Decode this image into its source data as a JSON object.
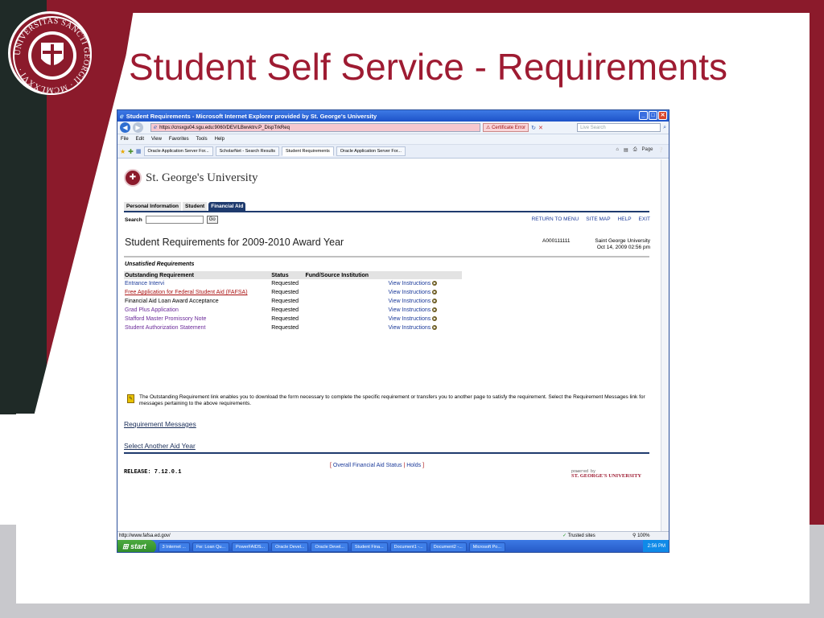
{
  "slide": {
    "title": "Student Self Service - Requirements",
    "seal_text": "UNIVERSITAS SANCTI GEORGII · MCMLXXVI ·",
    "colors": {
      "brand": "#8b1a2b",
      "title": "#9e1b32"
    }
  },
  "browser": {
    "title": "Student Requirements - Microsoft Internet Explorer provided by St. George's University",
    "address": "https://cnsxgu04.sgu.edu:9060/DEV/LBwvktrv.P_DispTrkReq",
    "cert_error": "Certificate Error",
    "search_placeholder": "Live Search",
    "menu": [
      "File",
      "Edit",
      "View",
      "Favorites",
      "Tools",
      "Help"
    ],
    "tabs": [
      "Oracle Application Server For...",
      "ScholarNet - Search Results",
      "Student Requirements",
      "Oracle Application Server For..."
    ],
    "tools": {
      "page": "Page",
      "tools": ""
    },
    "status_url": "http://www.fafsa.ed.gov/",
    "status_zone": "Trusted sites",
    "status_zoom": "100%"
  },
  "page": {
    "university": "St. George's University",
    "ptabs": [
      "Personal Information",
      "Student",
      "Financial Aid"
    ],
    "search_label": "Search",
    "go_label": "Go",
    "top_links": [
      "RETURN TO MENU",
      "SITE MAP",
      "HELP",
      "EXIT"
    ],
    "heading": "Student Requirements for 2009-2010 Award Year",
    "student_id": "A000111111",
    "institution": "Saint George University",
    "date": "Oct 14, 2009 02:56 pm",
    "unsatisfied_label": "Unsatisfied Requirements",
    "columns": [
      "Outstanding Requirement",
      "Status",
      "Fund/Source Institution"
    ],
    "rows": [
      {
        "requirement": "Entrance Intervi",
        "status": "Requested",
        "instructions": "View Instructions"
      },
      {
        "requirement": "Free Application for Federal Student Aid (FAFSA)",
        "status": "Requested",
        "instructions": "View Instructions"
      },
      {
        "requirement": "Financial Aid Loan Award Acceptance",
        "status": "Requested",
        "instructions": "View Instructions"
      },
      {
        "requirement": "Grad Plus Application",
        "status": "Requested",
        "instructions": "View Instructions"
      },
      {
        "requirement": "Stafford Master Promissory Note",
        "status": "Requested",
        "instructions": "View Instructions"
      },
      {
        "requirement": "Student Authorization Statement",
        "status": "Requested",
        "instructions": "View Instructions"
      }
    ],
    "note": "The Outstanding Requirement link enables you to download the form necessary to complete the specific requirement or transfers you to another page to satisfy the requirement. Select the Requirement Messages link for messages pertaining to the above requirements.",
    "requirement_messages": "Requirement Messages",
    "select_another_year": "Select Another Aid Year",
    "footer_links": [
      "Overall Financial Aid Status",
      "Holds"
    ],
    "release": "RELEASE: 7.12.0.1",
    "powered_by": "powered by",
    "powered_by_mark": "ST. GEORGE'S UNIVERSITY"
  },
  "taskbar": {
    "start": "start",
    "tasks": [
      "3 Internet ...",
      "Fw: Loan Qu...",
      "PowerFAIDS...",
      "Oracle Devel...",
      "Oracle Devel...",
      "Student Fina...",
      "Document1 -...",
      "Document2 -...",
      "Microsoft Po..."
    ],
    "clock": "2:56 PM"
  }
}
